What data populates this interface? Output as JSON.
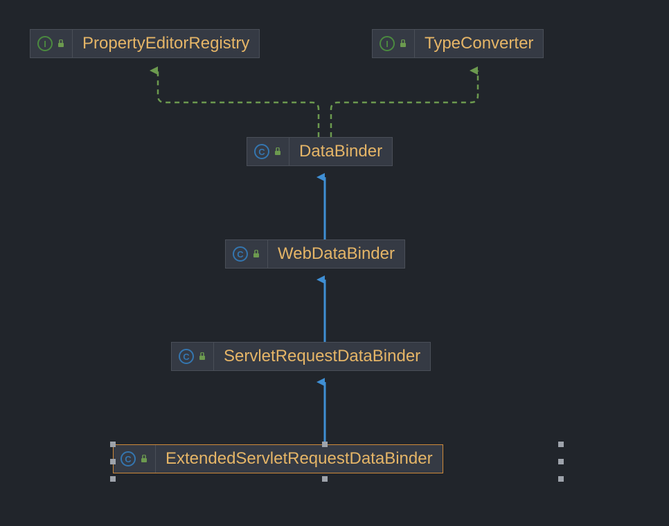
{
  "diagram": {
    "type": "class-hierarchy",
    "nodes": {
      "propertyEditorRegistry": {
        "label": "PropertyEditorRegistry",
        "kind": "interface"
      },
      "typeConverter": {
        "label": "TypeConverter",
        "kind": "interface"
      },
      "dataBinder": {
        "label": "DataBinder",
        "kind": "class"
      },
      "webDataBinder": {
        "label": "WebDataBinder",
        "kind": "class"
      },
      "servletRequestDataBinder": {
        "label": "ServletRequestDataBinder",
        "kind": "class"
      },
      "extendedServletRequestDataBinder": {
        "label": "ExtendedServletRequestDataBinder",
        "kind": "class",
        "selected": true
      }
    },
    "edges": [
      {
        "from": "dataBinder",
        "to": "propertyEditorRegistry",
        "relation": "implements"
      },
      {
        "from": "dataBinder",
        "to": "typeConverter",
        "relation": "implements"
      },
      {
        "from": "webDataBinder",
        "to": "dataBinder",
        "relation": "extends"
      },
      {
        "from": "servletRequestDataBinder",
        "to": "webDataBinder",
        "relation": "extends"
      },
      {
        "from": "extendedServletRequestDataBinder",
        "to": "servletRequestDataBinder",
        "relation": "extends"
      }
    ],
    "icons": {
      "interface_letter": "I",
      "class_letter": "C"
    }
  }
}
